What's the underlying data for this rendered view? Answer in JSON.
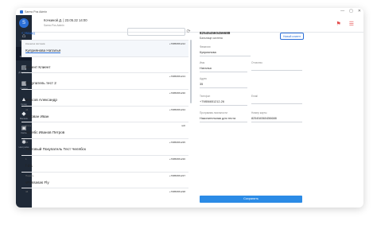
{
  "window": {
    "title": "Sarmo Pos Admin",
    "controls": [
      "—",
      "▢",
      "✕"
    ]
  },
  "sidebar": {
    "avatar_letter": "S",
    "items": [
      {
        "label": "Главная",
        "icon": "home-icon",
        "glyph": "⌂"
      },
      {
        "label": "Клиенты",
        "icon": "users-icon",
        "glyph": "☺"
      },
      {
        "label": "Документы",
        "icon": "document-icon",
        "glyph": "▤"
      },
      {
        "label": "Отчеты",
        "icon": "report-icon",
        "glyph": "▦"
      },
      {
        "label": "Склад",
        "icon": "warehouse-icon",
        "glyph": "▲"
      },
      {
        "label": "Магазин",
        "icon": "store-icon",
        "glyph": "◆"
      },
      {
        "label": "Касса",
        "icon": "cash-icon",
        "glyph": "▣"
      },
      {
        "label": "Настройки",
        "icon": "settings-icon",
        "glyph": "✱"
      }
    ]
  },
  "topbar": {
    "user_name": "Кочкиной Д. | 23.05.22 14:00",
    "user_sub": "Sarmo Pos Admin"
  },
  "left": {
    "back_label": "< Назад",
    "rows": [
      {
        "card": "Кошелек система",
        "phone": "+79856651212",
        "name": "Куприянова Наталья",
        "active": true
      },
      {
        "card": "",
        "phone": "",
        "name": "Клиент Клиент",
        "active": false
      },
      {
        "card": "",
        "phone": "+79856651213",
        "name": "Покупатель тест 2",
        "active": false
      },
      {
        "card": "",
        "phone": "+79856651230",
        "name": "Власов Александр",
        "active": false
      },
      {
        "card": "44",
        "phone": "+79856651234",
        "name": "Голован Иван",
        "active": false
      },
      {
        "card": "Anna",
        "phone": "noft",
        "name": "Челябс Иванов Петров",
        "active": false
      },
      {
        "card": "44",
        "phone": "+79856651235",
        "name": "Тестовый Покупатель Тест Челябск",
        "active": false
      },
      {
        "card": "1",
        "phone": "+79856651236",
        "name": "f d s",
        "active": false
      },
      {
        "card": "Пароль",
        "phone": "+79856651237",
        "name": "vPassasas Fly",
        "active": false
      },
      {
        "card": "44",
        "phone": "+79856651238",
        "name": "",
        "active": false
      }
    ]
  },
  "right": {
    "title": "825454560456688",
    "subtitle": "Бальнице систена",
    "new_button": "Новый клиент",
    "fields": {
      "lastname_label": "Фамилия",
      "lastname_value": "Куприянова",
      "firstname_label": "Имя",
      "firstname_value": "Наталья",
      "middlename_label": "Отчество",
      "middlename_value": "",
      "age_label": "Адрес",
      "age_value": "35",
      "phone_label": "Телефон",
      "phone_value": "+79856651212-26",
      "email_label": "Email",
      "email_value": "",
      "program_label": "Программа лояльности",
      "program_value": "Накопительная для теста",
      "card_label": "Номер карты",
      "card_value": "825454560456688"
    },
    "save_button": "Сохранить"
  }
}
